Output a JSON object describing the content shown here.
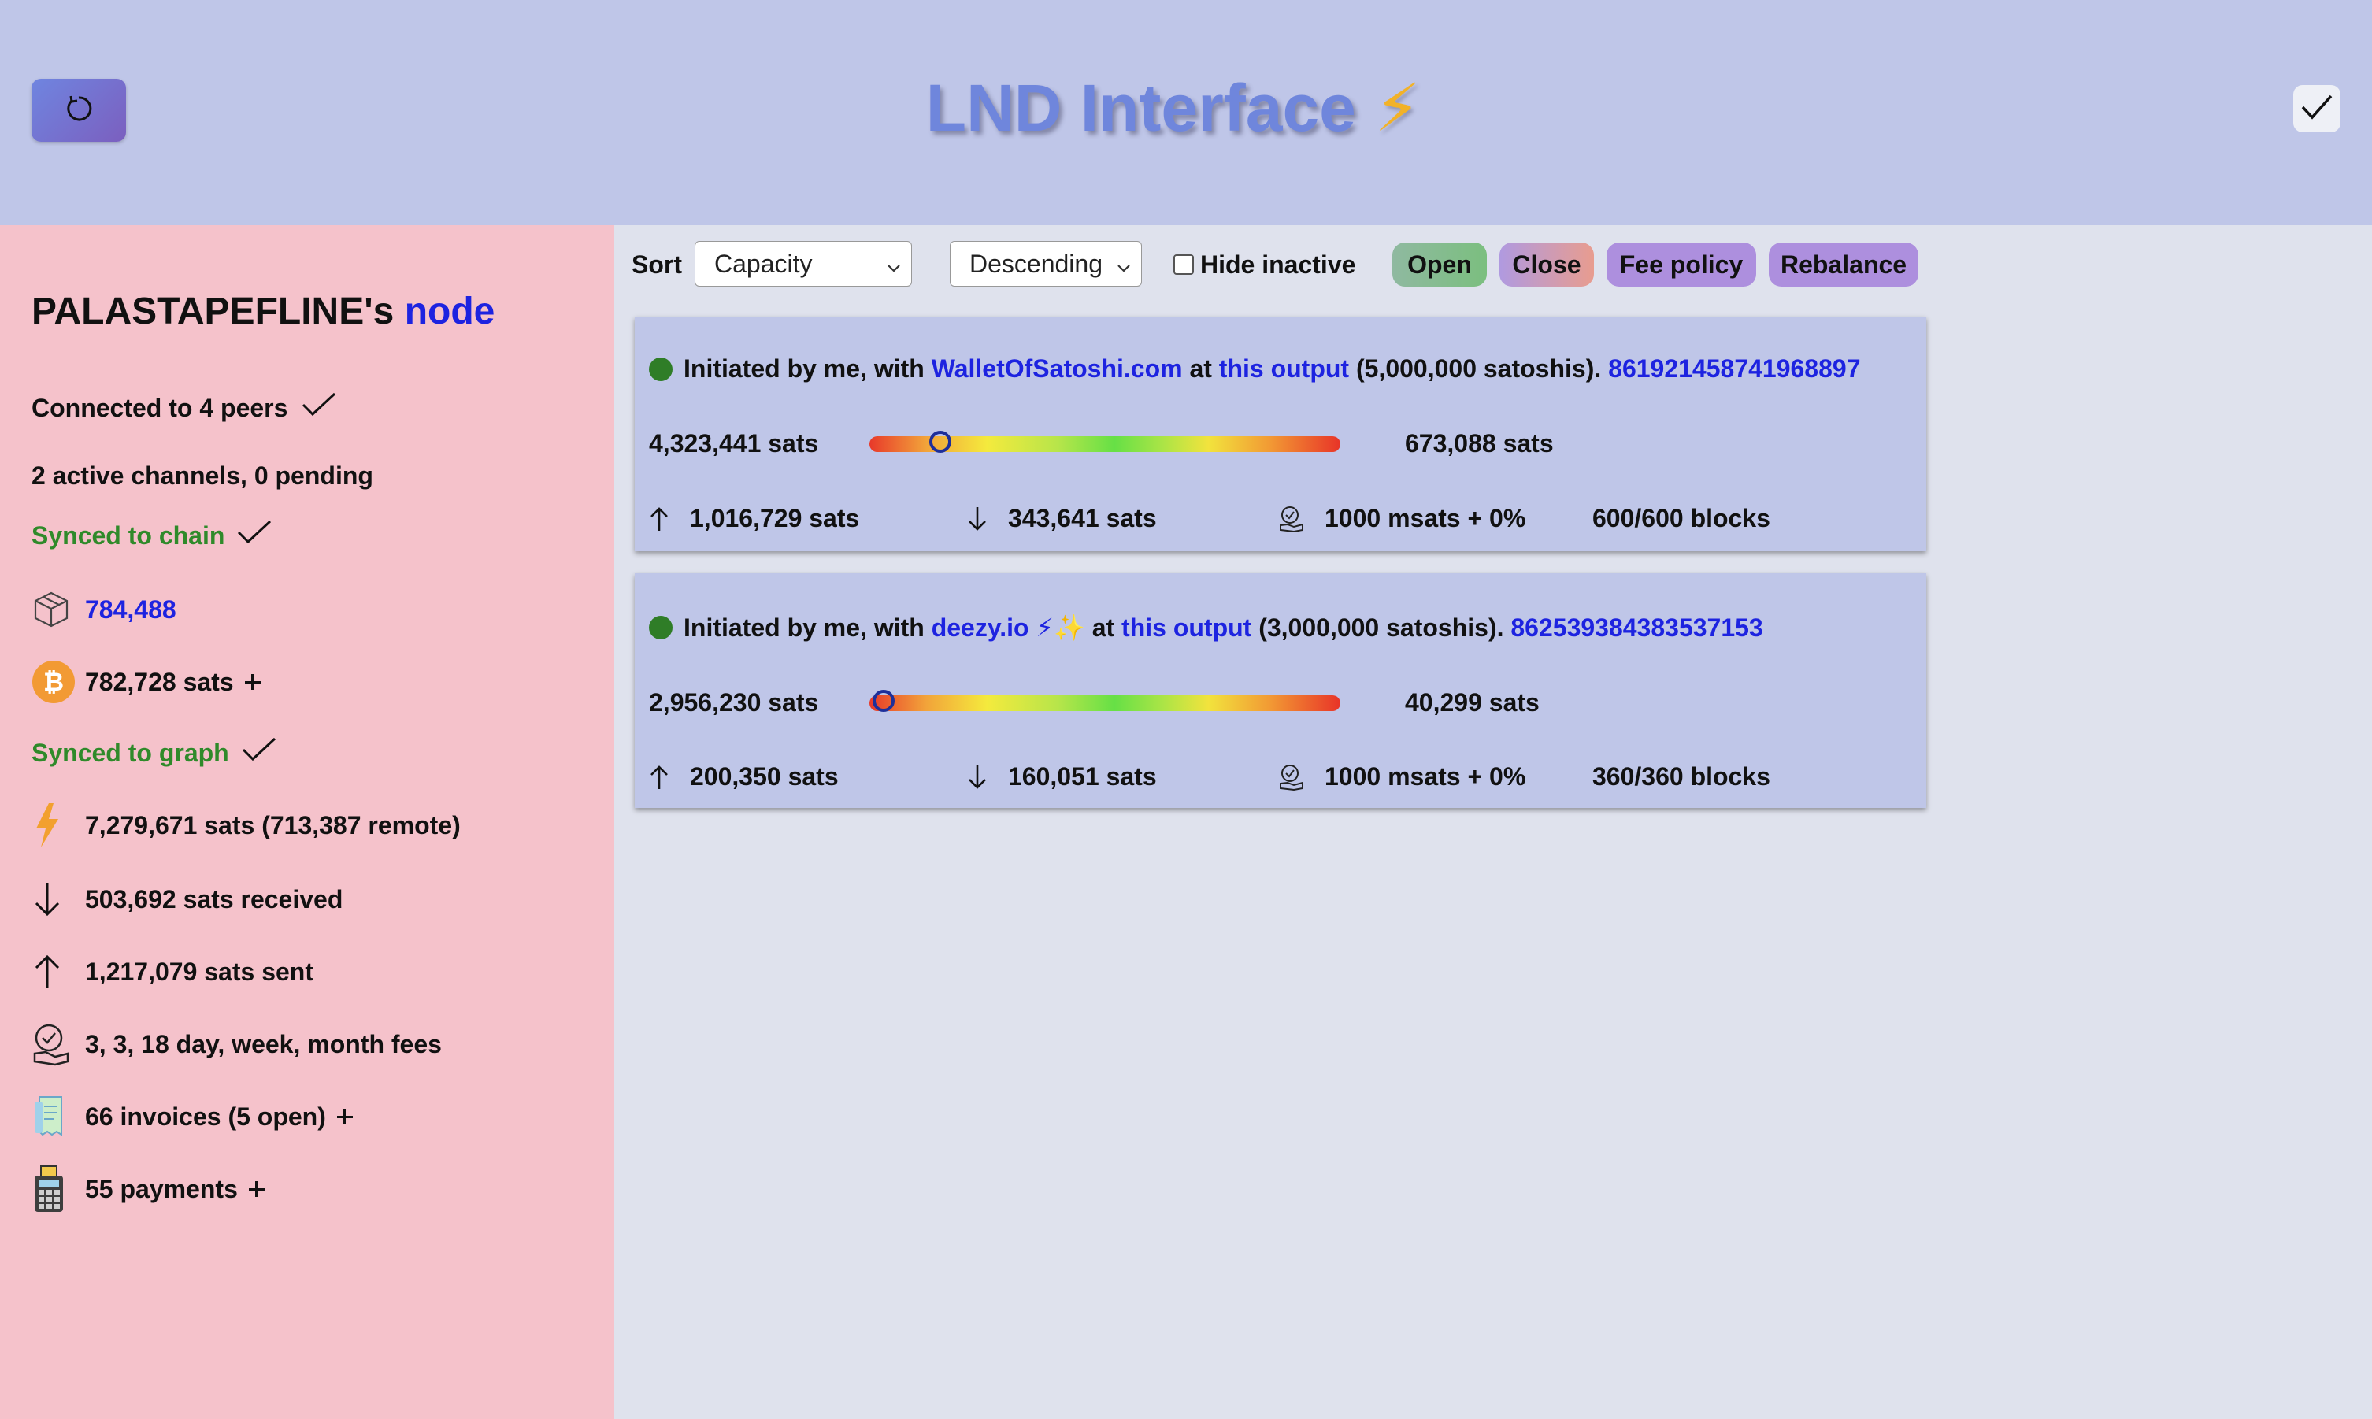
{
  "header": {
    "title": "LND Interface",
    "title_emoji": "⚡",
    "refresh_icon": "refresh-icon",
    "check_icon": "checkmark-icon"
  },
  "sidebar": {
    "node_owner": "PALASTAPEFLINE's",
    "node_link": "node",
    "peers": "Connected to 4 peers",
    "channels": "2 active channels, 0 pending",
    "synced_chain": "Synced to chain",
    "block_height": "784,488",
    "onchain_balance": "782,728 sats",
    "synced_graph": "Synced to graph",
    "lightning_balance": "7,279,671 sats (713,387 remote)",
    "received": "503,692 sats received",
    "sent": "1,217,079 sats sent",
    "fees": "3, 3, 18 day, week, month fees",
    "invoices": "66 invoices (5 open)",
    "payments": "55 payments"
  },
  "toolbar": {
    "sort_label": "Sort",
    "sort_value": "Capacity",
    "order_value": "Descending",
    "hide_inactive": "Hide inactive",
    "hide_inactive_checked": false,
    "open": "Open",
    "close": "Close",
    "fee_policy": "Fee policy",
    "rebalance": "Rebalance"
  },
  "channels": [
    {
      "status_color": "#2f7d27",
      "prefix": "Initiated by me, with",
      "peer": "WalletOfSatoshi.com",
      "at": "at",
      "output_link": "this output",
      "capacity": "(5,000,000 satoshis).",
      "channel_id": "861921458741968897",
      "local": "4,323,441 sats",
      "remote": "673,088 sats",
      "balance_fraction": 0.15,
      "sent": "1,016,729 sats",
      "received": "343,641 sats",
      "fee": "1000 msats + 0%",
      "blocks": "600/600 blocks"
    },
    {
      "status_color": "#2f7d27",
      "prefix": "Initiated by me, with",
      "peer": "deezy.io ⚡✨",
      "at": "at",
      "output_link": "this output",
      "capacity": "(3,000,000 satoshis).",
      "channel_id": "862539384383537153",
      "local": "2,956,230 sats",
      "remote": "40,299 sats",
      "balance_fraction": 0.03,
      "sent": "200,350 sats",
      "received": "160,051 sats",
      "fee": "1000 msats + 0%",
      "blocks": "360/360 blocks"
    }
  ]
}
